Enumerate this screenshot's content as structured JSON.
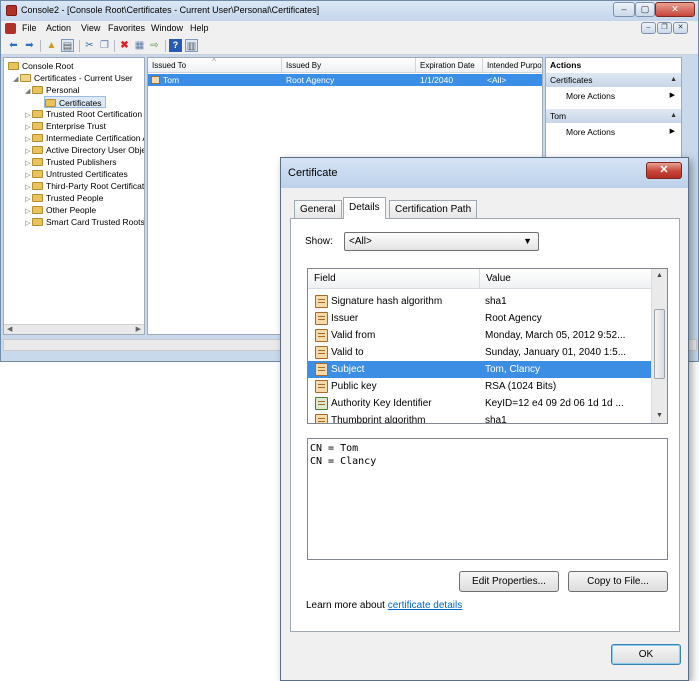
{
  "mmc": {
    "title": "Console2 - [Console Root\\Certificates - Current User\\Personal\\Certificates]",
    "menu": [
      "File",
      "Action",
      "View",
      "Favorites",
      "Window",
      "Help"
    ],
    "tree": [
      {
        "label": "Console Root",
        "depth": 0
      },
      {
        "label": "Certificates - Current User",
        "depth": 1
      },
      {
        "label": "Personal",
        "depth": 2
      },
      {
        "label": "Certificates",
        "depth": 3
      },
      {
        "label": "Trusted Root Certification Au",
        "depth": 2
      },
      {
        "label": "Enterprise Trust",
        "depth": 2
      },
      {
        "label": "Intermediate Certification Au",
        "depth": 2
      },
      {
        "label": "Active Directory User Object",
        "depth": 2
      },
      {
        "label": "Trusted Publishers",
        "depth": 2
      },
      {
        "label": "Untrusted Certificates",
        "depth": 2
      },
      {
        "label": "Third-Party Root Certificatio",
        "depth": 2
      },
      {
        "label": "Trusted People",
        "depth": 2
      },
      {
        "label": "Other People",
        "depth": 2
      },
      {
        "label": "Smart Card Trusted Roots",
        "depth": 2
      }
    ],
    "columns": [
      "Issued To",
      "Issued By",
      "Expiration Date",
      "Intended Purpo"
    ],
    "row": {
      "issued_to": "Tom",
      "issued_by": "Root Agency",
      "expiration": "1/1/2040",
      "purpose": "<All>"
    },
    "actions": {
      "header": "Actions",
      "section1": "Certificates",
      "more1": "More Actions",
      "section2": "Tom",
      "more2": "More Actions"
    }
  },
  "dialog": {
    "title": "Certificate",
    "close": "✕",
    "tabs": [
      "General",
      "Details",
      "Certification Path"
    ],
    "show_label": "Show:",
    "show_value": "<All>",
    "field_header": "Field",
    "value_header": "Value",
    "fields": [
      {
        "name": "Signature hash algorithm",
        "value": "sha1"
      },
      {
        "name": "Issuer",
        "value": "Root Agency"
      },
      {
        "name": "Valid from",
        "value": "Monday, March 05, 2012 9:52..."
      },
      {
        "name": "Valid to",
        "value": "Sunday, January 01, 2040 1:5..."
      },
      {
        "name": "Subject",
        "value": "Tom, Clancy"
      },
      {
        "name": "Public key",
        "value": "RSA (1024 Bits)"
      },
      {
        "name": "Authority Key Identifier",
        "value": "KeyID=12 e4 09 2d 06 1d 1d ..."
      },
      {
        "name": "Thumbprint algorithm",
        "value": "sha1"
      }
    ],
    "detail_lines": [
      "CN = Tom",
      "CN = Clancy"
    ],
    "edit_properties": "Edit Properties...",
    "copy_to_file": "Copy to File...",
    "learn_prefix": "Learn more about ",
    "learn_link": "certificate details",
    "ok": "OK"
  }
}
